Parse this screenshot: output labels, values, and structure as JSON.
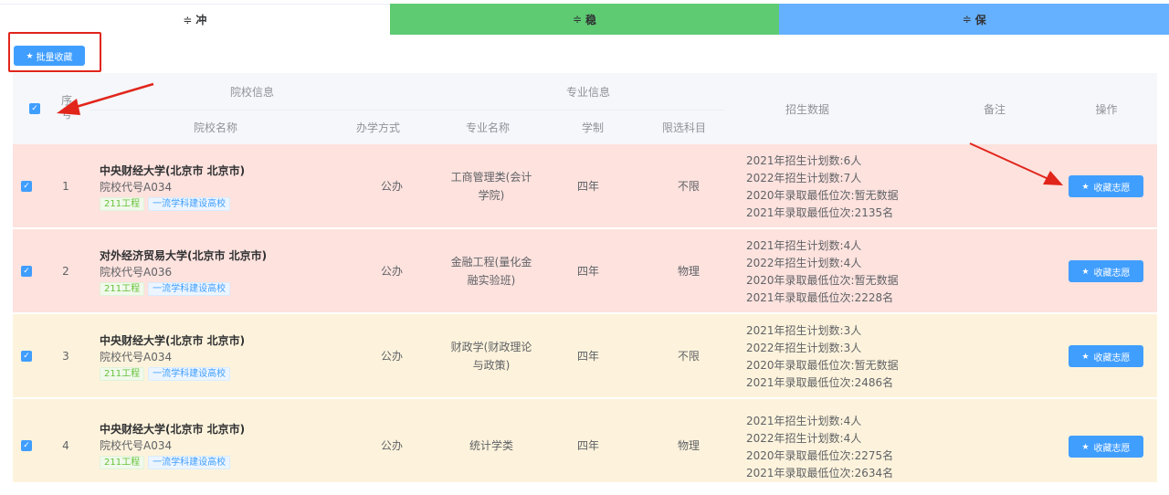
{
  "tabs": [
    {
      "icon": "≑",
      "label": "冲"
    },
    {
      "icon": "≑",
      "label": "稳"
    },
    {
      "icon": "≑",
      "label": "保"
    }
  ],
  "toolbar": {
    "batch_icon": "★",
    "batch_label": "批量收藏"
  },
  "header": {
    "seq": "序号",
    "school_info": "院校信息",
    "school_name": "院校名称",
    "run_type": "办学方式",
    "major_info": "专业信息",
    "major_name": "专业名称",
    "duration": "学制",
    "subject": "限选科目",
    "enroll_data": "招生数据",
    "remark": "备注",
    "action": "操作"
  },
  "check_glyph": "✓",
  "rows": [
    {
      "index": "1",
      "name": "中央财经大学(北京市 北京市)",
      "code": "院校代号A034",
      "tag1": "211工程",
      "tag2": "一流学科建设高校",
      "run_type": "公办",
      "major": "工商管理类(会计学院)",
      "duration": "四年",
      "subject": "不限",
      "stats": [
        "2021年招生计划数:6人",
        "2022年招生计划数:7人",
        "2020年录取最低位次:暂无数据",
        "2021年录取最低位次:2135名"
      ],
      "action_label": "收藏志愿",
      "action_icon": "★"
    },
    {
      "index": "2",
      "name": "对外经济贸易大学(北京市 北京市)",
      "code": "院校代号A036",
      "tag1": "211工程",
      "tag2": "一流学科建设高校",
      "run_type": "公办",
      "major": "金融工程(量化金融实验班)",
      "duration": "四年",
      "subject": "物理",
      "stats": [
        "2021年招生计划数:4人",
        "2022年招生计划数:4人",
        "2020年录取最低位次:暂无数据",
        "2021年录取最低位次:2228名"
      ],
      "action_label": "收藏志愿",
      "action_icon": "★"
    },
    {
      "index": "3",
      "name": "中央财经大学(北京市 北京市)",
      "code": "院校代号A034",
      "tag1": "211工程",
      "tag2": "一流学科建设高校",
      "run_type": "公办",
      "major": "财政学(财政理论与政策)",
      "duration": "四年",
      "subject": "不限",
      "stats": [
        "2021年招生计划数:3人",
        "2022年招生计划数:3人",
        "2020年录取最低位次:暂无数据",
        "2021年录取最低位次:2486名"
      ],
      "action_label": "收藏志愿",
      "action_icon": "★"
    },
    {
      "index": "4",
      "name": "中央财经大学(北京市 北京市)",
      "code": "院校代号A034",
      "tag1": "211工程",
      "tag2": "一流学科建设高校",
      "run_type": "公办",
      "major": "统计学类",
      "duration": "四年",
      "subject": "物理",
      "stats": [
        "2021年招生计划数:4人",
        "2022年招生计划数:4人",
        "2020年录取最低位次:2275名",
        "2021年录取最低位次:2634名"
      ],
      "action_label": "收藏志愿",
      "action_icon": "★"
    }
  ],
  "colors": {
    "row_red": "#fde2de",
    "row_yellow": "#fdf3dc",
    "arrow": "#e1251b"
  }
}
